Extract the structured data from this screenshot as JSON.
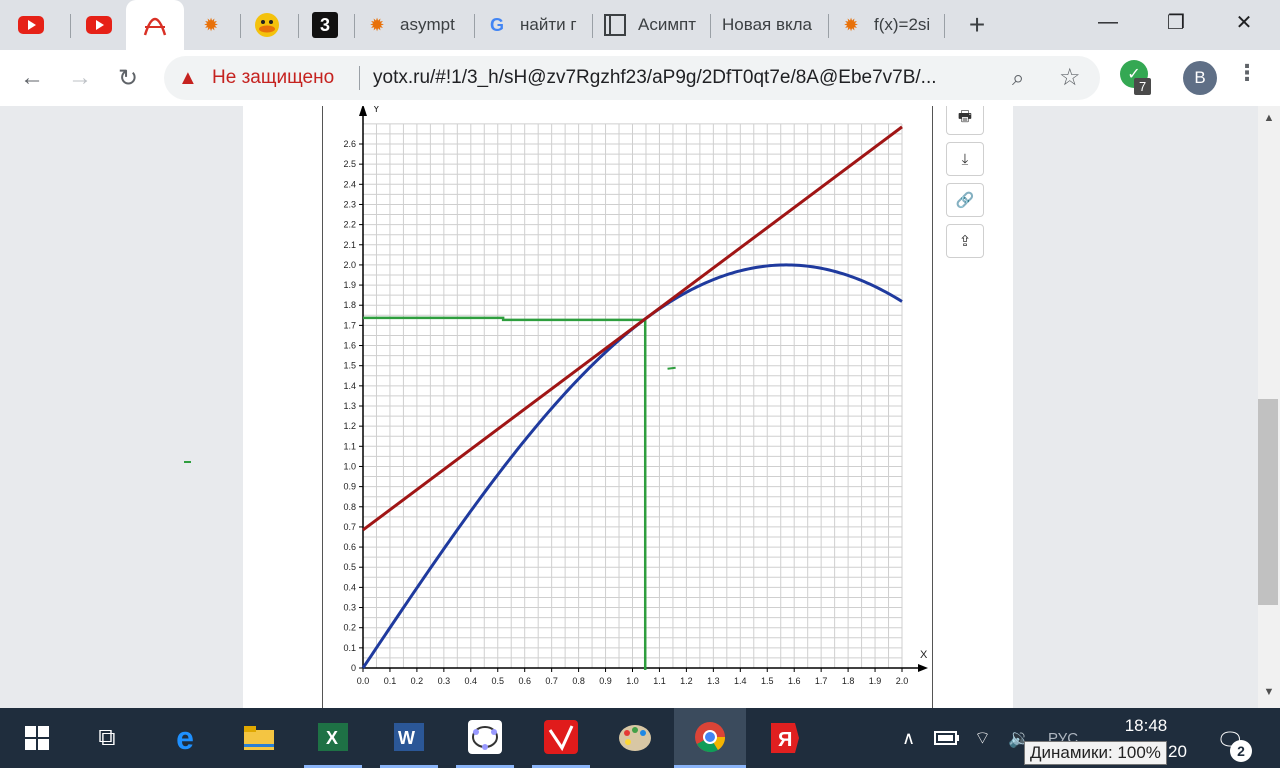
{
  "tabs": [
    {
      "icon": "youtube-icon",
      "label": ""
    },
    {
      "icon": "youtube-icon",
      "label": ""
    },
    {
      "icon": "graph-app-icon",
      "label": "",
      "active": true
    },
    {
      "icon": "sun-icon",
      "label": ""
    },
    {
      "icon": "duck-icon",
      "label": ""
    },
    {
      "icon": "three-icon",
      "label": "3"
    },
    {
      "icon": "sun-icon",
      "label": "asympt"
    },
    {
      "icon": "google-icon",
      "label": "найти г"
    },
    {
      "icon": "page-icon",
      "label": "Асимпт"
    },
    {
      "icon": "",
      "label": "Новая вкла"
    },
    {
      "icon": "sun-icon",
      "label": "f(x)=2si"
    }
  ],
  "toolbar": {
    "security_text": "Не защищено",
    "url": "yotx.ru/#!1/3_h/sH@zv7Rgzhf23/aP9g/2DfT0qt7e/8A@Ebe7v7B/...",
    "extension_badge": "7",
    "avatar_letter": "B"
  },
  "graph": {
    "x_axis_label": "X",
    "y_axis_label": "Y",
    "x_ticks": [
      "0.0",
      "0.1",
      "0.2",
      "0.3",
      "0.4",
      "0.5",
      "0.6",
      "0.7",
      "0.8",
      "0.9",
      "1.0",
      "1.1",
      "1.2",
      "1.3",
      "1.4",
      "1.5",
      "1.6",
      "1.7",
      "1.8",
      "1.9",
      "2.0"
    ],
    "y_ticks": [
      "0",
      "0.1",
      "0.2",
      "0.3",
      "0.4",
      "0.5",
      "0.6",
      "0.7",
      "0.8",
      "0.9",
      "1.0",
      "1.1",
      "1.2",
      "1.3",
      "1.4",
      "1.5",
      "1.6",
      "1.7",
      "1.8",
      "1.9",
      "2.0",
      "2.1",
      "2.2",
      "2.3",
      "2.4",
      "2.5",
      "2.6"
    ],
    "xlim": [
      0,
      2.0
    ],
    "ylim": [
      0,
      2.6
    ],
    "curve_color": "#1f3a9e",
    "tangent_color": "#a01515",
    "guide_color": "#2e9e3e",
    "point": {
      "x": 1.0472,
      "y": 1.732
    },
    "tangent_slope": 1.0,
    "tangent_intercept": 0.685
  },
  "chart_data": {
    "type": "line",
    "title": "",
    "xlabel": "X",
    "ylabel": "Y",
    "xlim": [
      0,
      2.0
    ],
    "ylim": [
      0,
      2.6
    ],
    "grid": true,
    "series": [
      {
        "x": [
          0,
          0.2,
          0.4,
          0.6,
          0.8,
          1.0,
          1.2,
          1.4,
          1.5708,
          1.8,
          2.0
        ],
        "y": [
          0,
          0.397,
          0.779,
          1.129,
          1.435,
          1.683,
          1.864,
          1.971,
          2.0,
          1.948,
          1.819
        ]
      },
      {
        "x": [
          0,
          2.0
        ],
        "y": [
          0.685,
          2.685
        ]
      },
      {
        "x": [
          0,
          1.0472,
          1.0472
        ],
        "y": [
          1.732,
          1.732,
          0
        ]
      }
    ]
  },
  "side_buttons": [
    {
      "name": "print-button",
      "icon": "print-icon",
      "glyph": "🖶"
    },
    {
      "name": "download-button",
      "icon": "download-icon",
      "glyph": "⤓"
    },
    {
      "name": "link-button",
      "icon": "link-icon",
      "glyph": "🔗"
    },
    {
      "name": "share-button",
      "icon": "share-icon",
      "glyph": "⇪"
    }
  ],
  "taskbar": {
    "clock_time": "18:48",
    "clock_date_fragment": "20",
    "language": "РУС",
    "tooltip": "Динамики: 100%",
    "notification_count": "2"
  }
}
